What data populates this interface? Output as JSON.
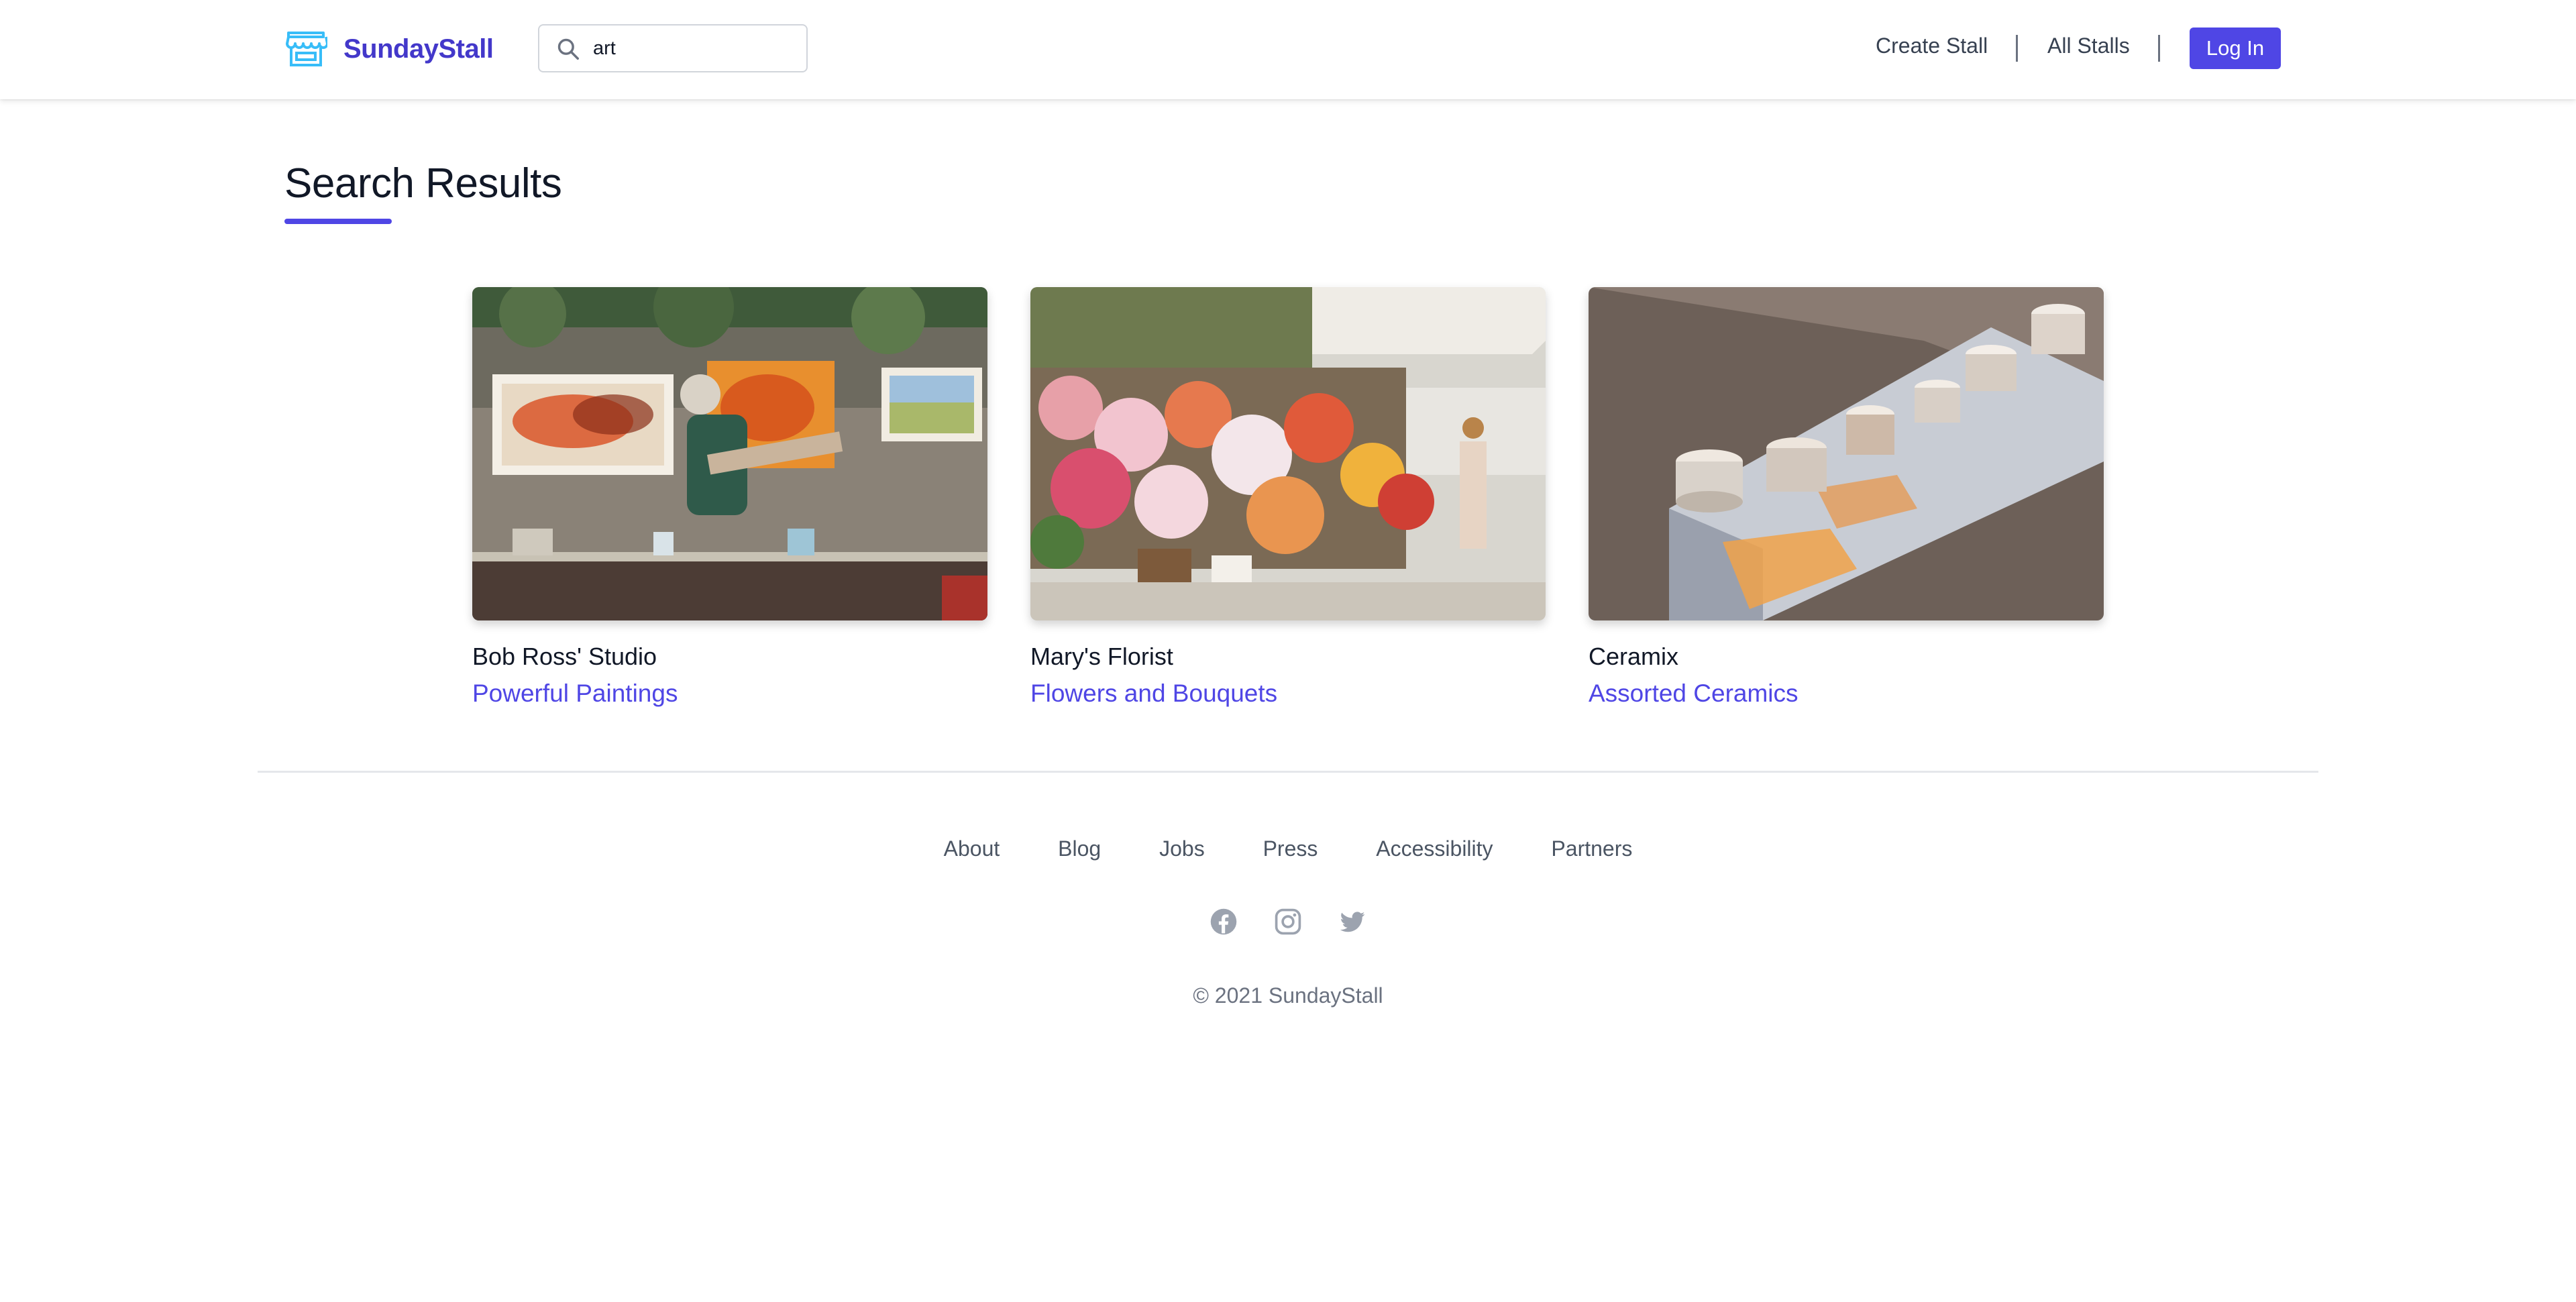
{
  "brand": {
    "name": "SundayStall",
    "logo_icon": "market-stall-icon"
  },
  "search": {
    "value": "art",
    "icon": "search-icon"
  },
  "nav": {
    "items": [
      {
        "label": "Create Stall"
      },
      {
        "label": "All Stalls"
      }
    ],
    "login_label": "Log In"
  },
  "main": {
    "title": "Search Results",
    "results": [
      {
        "name": "Bob Ross' Studio",
        "category": "Powerful Paintings"
      },
      {
        "name": "Mary's Florist",
        "category": "Flowers and Bouquets"
      },
      {
        "name": "Ceramix",
        "category": "Assorted Ceramics"
      }
    ]
  },
  "footer": {
    "links": [
      {
        "label": "About"
      },
      {
        "label": "Blog"
      },
      {
        "label": "Jobs"
      },
      {
        "label": "Press"
      },
      {
        "label": "Accessibility"
      },
      {
        "label": "Partners"
      }
    ],
    "social": [
      "facebook-icon",
      "instagram-icon",
      "twitter-icon"
    ],
    "copyright": "© 2021 SundayStall"
  },
  "colors": {
    "brand": "#4338ca",
    "accent": "#4f46e5",
    "text": "#111827",
    "muted": "#6b7280",
    "divider": "#e5e7eb"
  }
}
